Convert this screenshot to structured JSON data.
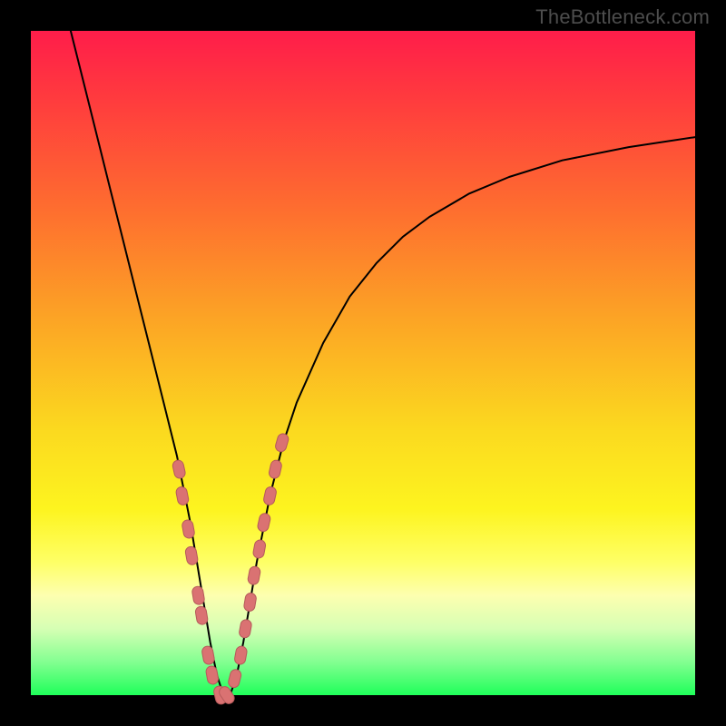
{
  "watermark": "TheBottleneck.com",
  "colors": {
    "frame": "#000000",
    "curve": "#000000",
    "marker_fill": "#da7272",
    "marker_stroke": "#b55a5a",
    "gradient_top": "#ff1d4a",
    "gradient_bottom": "#1fff5a"
  },
  "chart_data": {
    "type": "line",
    "title": "",
    "xlabel": "",
    "ylabel": "",
    "xlim": [
      0,
      100
    ],
    "ylim": [
      0,
      100
    ],
    "grid": false,
    "legend": false,
    "annotations": [
      "TheBottleneck.com"
    ],
    "series": [
      {
        "name": "bottleneck-curve",
        "x": [
          6,
          8,
          10,
          12,
          14,
          16,
          18,
          20,
          21,
          22,
          23,
          24,
          25,
          26,
          27,
          28,
          29,
          30,
          31,
          32,
          33,
          34,
          36,
          38,
          40,
          44,
          48,
          52,
          56,
          60,
          66,
          72,
          80,
          90,
          100
        ],
        "y": [
          100,
          92,
          84,
          76,
          68,
          60,
          52,
          44,
          40,
          36,
          31,
          26,
          20,
          14,
          8,
          3,
          0,
          0,
          3,
          8,
          14,
          20,
          30,
          38,
          44,
          53,
          60,
          65,
          69,
          72,
          75.5,
          78,
          80.5,
          82.5,
          84
        ]
      }
    ],
    "markers": {
      "name": "highlighted-points",
      "x": [
        22.3,
        22.8,
        23.7,
        24.2,
        25.2,
        25.7,
        26.7,
        27.3,
        28.5,
        29.5,
        30.7,
        31.6,
        32.3,
        33.0,
        33.6,
        34.4,
        35.1,
        36.0,
        36.8,
        37.8
      ],
      "y": [
        34,
        30,
        25,
        21,
        15,
        12,
        6,
        3,
        0,
        0,
        2.5,
        6,
        10,
        14,
        18,
        22,
        26,
        30,
        34,
        38
      ]
    }
  }
}
